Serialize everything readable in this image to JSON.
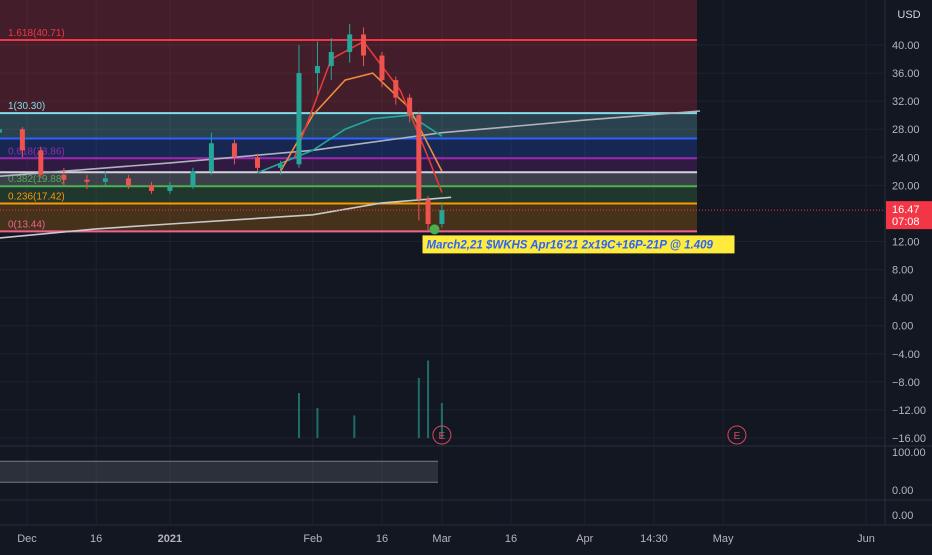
{
  "chart_data": {
    "type": "candlestick",
    "title": "",
    "currency": "USD",
    "time_axis": {
      "ticks": [
        {
          "label": "Dec",
          "date": "2020-12-01",
          "bold": false
        },
        {
          "label": "16",
          "date": "2020-12-16",
          "bold": false
        },
        {
          "label": "2021",
          "date": "2021-01-01",
          "bold": true
        },
        {
          "label": "Feb",
          "date": "2021-02-01",
          "bold": false
        },
        {
          "label": "16",
          "date": "2021-02-16",
          "bold": false
        },
        {
          "label": "Mar",
          "date": "2021-03-01",
          "bold": false
        },
        {
          "label": "16",
          "date": "2021-03-16",
          "bold": false
        },
        {
          "label": "Apr",
          "date": "2021-04-01",
          "bold": false
        },
        {
          "label": "14:30",
          "date": "2021-04-16",
          "bold": false
        },
        {
          "label": "May",
          "date": "2021-05-01",
          "bold": false
        },
        {
          "label": "Jun",
          "date": "2021-06-01",
          "bold": false
        }
      ]
    },
    "price_axis": {
      "ticks": [
        "40.00",
        "36.00",
        "32.00",
        "28.00",
        "24.00",
        "20.00",
        "12.00",
        "8.00",
        "4.00",
        "0.00",
        "−4.00",
        "−8.00",
        "−12.00",
        "−16.00"
      ],
      "range": [
        -16.5,
        43
      ]
    },
    "last_price": {
      "value": 16.47,
      "label": "16.47",
      "countdown": "07:08",
      "color": "#f23645"
    },
    "fib_levels": [
      {
        "label": "1.618(40.71)",
        "value": 40.71,
        "color": "#f23645",
        "show_label": true
      },
      {
        "label": "1(30.30)",
        "value": 30.3,
        "color": "#80deea",
        "show_label": true
      },
      {
        "label": "0.786(26.68)",
        "value": 26.68,
        "color": "#2962ff",
        "show_label": false
      },
      {
        "label": "0.618(23.86)",
        "value": 23.86,
        "color": "#9c27b0",
        "show_label": true
      },
      {
        "label": "0.5(21.87)",
        "value": 21.87,
        "color": "#d1d4dc",
        "show_label": false
      },
      {
        "label": "0.382(19.88)",
        "value": 19.88,
        "color": "#4caf50",
        "show_label": true
      },
      {
        "label": "0.236(17.42)",
        "value": 17.42,
        "color": "#ff9800",
        "show_label": true
      },
      {
        "label": "0(13.44)",
        "value": 13.44,
        "color": "#f06292",
        "show_label": true
      }
    ],
    "price_series": [
      {
        "date": "2020-11-25",
        "open": 27.5,
        "high": 29.5,
        "low": 26.5,
        "close": 28.0
      },
      {
        "date": "2020-11-30",
        "open": 28.0,
        "high": 28.3,
        "low": 24.0,
        "close": 25.0
      },
      {
        "date": "2020-12-04",
        "open": 25.0,
        "high": 25.5,
        "low": 21.0,
        "close": 21.5
      },
      {
        "date": "2020-12-09",
        "open": 21.5,
        "high": 22.5,
        "low": 19.8,
        "close": 20.8
      },
      {
        "date": "2020-12-14",
        "open": 20.8,
        "high": 21.5,
        "low": 19.5,
        "close": 20.5
      },
      {
        "date": "2020-12-18",
        "open": 20.5,
        "high": 22.0,
        "low": 20.0,
        "close": 21.0
      },
      {
        "date": "2020-12-23",
        "open": 21.0,
        "high": 21.5,
        "low": 19.5,
        "close": 20.0
      },
      {
        "date": "2020-12-28",
        "open": 20.0,
        "high": 20.5,
        "low": 18.8,
        "close": 19.2
      },
      {
        "date": "2021-01-01",
        "open": 19.2,
        "high": 20.5,
        "low": 18.8,
        "close": 19.8
      },
      {
        "date": "2021-01-06",
        "open": 19.8,
        "high": 22.5,
        "low": 19.5,
        "close": 22.0
      },
      {
        "date": "2021-01-10",
        "open": 22.0,
        "high": 27.5,
        "low": 21.5,
        "close": 26.0
      },
      {
        "date": "2021-01-15",
        "open": 26.0,
        "high": 26.5,
        "low": 23.0,
        "close": 24.0
      },
      {
        "date": "2021-01-20",
        "open": 24.0,
        "high": 24.5,
        "low": 22.0,
        "close": 22.5
      },
      {
        "date": "2021-01-25",
        "open": 22.5,
        "high": 23.5,
        "low": 21.5,
        "close": 23.0
      },
      {
        "date": "2021-01-29",
        "open": 23.0,
        "high": 40.0,
        "low": 22.5,
        "close": 36.0
      },
      {
        "date": "2021-02-02",
        "open": 36.0,
        "high": 40.5,
        "low": 33.0,
        "close": 37.0
      },
      {
        "date": "2021-02-05",
        "open": 37.0,
        "high": 41.0,
        "low": 35.0,
        "close": 39.0
      },
      {
        "date": "2021-02-09",
        "open": 39.0,
        "high": 43.0,
        "low": 37.5,
        "close": 41.5
      },
      {
        "date": "2021-02-12",
        "open": 41.5,
        "high": 42.5,
        "low": 37.0,
        "close": 38.5
      },
      {
        "date": "2021-02-16",
        "open": 38.5,
        "high": 39.0,
        "low": 34.0,
        "close": 35.0
      },
      {
        "date": "2021-02-19",
        "open": 35.0,
        "high": 35.5,
        "low": 31.5,
        "close": 32.5
      },
      {
        "date": "2021-02-22",
        "open": 32.5,
        "high": 33.0,
        "low": 29.0,
        "close": 30.0
      },
      {
        "date": "2021-02-24",
        "open": 30.0,
        "high": 30.5,
        "low": 15.0,
        "close": 18.0
      },
      {
        "date": "2021-02-26",
        "open": 18.0,
        "high": 18.5,
        "low": 13.5,
        "close": 14.5
      },
      {
        "date": "2021-03-01",
        "open": 14.5,
        "high": 17.5,
        "low": 14.0,
        "close": 16.47
      }
    ],
    "moving_averages": [
      {
        "color": "#c9c9c9",
        "points": [
          {
            "date": "2020-11-25",
            "value": 12.5
          },
          {
            "date": "2020-12-16",
            "value": 13.8
          },
          {
            "date": "2021-01-01",
            "value": 14.5
          },
          {
            "date": "2021-02-01",
            "value": 15.8
          },
          {
            "date": "2021-02-16",
            "value": 17.5
          },
          {
            "date": "2021-03-03",
            "value": 18.3
          }
        ]
      },
      {
        "color": "#b0b3bd",
        "points": [
          {
            "date": "2020-11-25",
            "value": 21.3
          },
          {
            "date": "2021-01-01",
            "value": 23.2
          },
          {
            "date": "2021-02-01",
            "value": 25.0
          },
          {
            "date": "2021-03-01",
            "value": 27.5
          },
          {
            "date": "2021-04-01",
            "value": 29.3
          },
          {
            "date": "2021-04-26",
            "value": 30.6
          }
        ]
      },
      {
        "color": "#26a69a",
        "points": [
          {
            "date": "2021-01-20",
            "value": 21.8
          },
          {
            "date": "2021-02-01",
            "value": 25.0
          },
          {
            "date": "2021-02-08",
            "value": 28.0
          },
          {
            "date": "2021-02-14",
            "value": 29.5
          },
          {
            "date": "2021-02-22",
            "value": 30.0
          },
          {
            "date": "2021-03-01",
            "value": 27.0
          }
        ]
      },
      {
        "color": "#ef8a3c",
        "points": [
          {
            "date": "2021-01-25",
            "value": 22.0
          },
          {
            "date": "2021-02-01",
            "value": 30.0
          },
          {
            "date": "2021-02-08",
            "value": 35.0
          },
          {
            "date": "2021-02-14",
            "value": 36.0
          },
          {
            "date": "2021-02-22",
            "value": 31.0
          },
          {
            "date": "2021-03-01",
            "value": 22.0
          }
        ]
      },
      {
        "color": "#e53935",
        "points": [
          {
            "date": "2021-01-28",
            "value": 24.0
          },
          {
            "date": "2021-02-05",
            "value": 38.0
          },
          {
            "date": "2021-02-12",
            "value": 40.5
          },
          {
            "date": "2021-02-20",
            "value": 33.5
          },
          {
            "date": "2021-02-26",
            "value": 24.0
          },
          {
            "date": "2021-03-01",
            "value": 19.0
          }
        ]
      }
    ],
    "annotation": {
      "text": "March2,21 $WKHS Apr16'21 2x19C+16P-21P @ 1.409",
      "date": "2021-03-02",
      "value": 13.44,
      "background": "#ffeb3b",
      "text_color": "#2962ff"
    },
    "earnings_markers": [
      {
        "label": "E",
        "date": "2021-03-01"
      },
      {
        "label": "E",
        "date": "2021-05-04"
      }
    ],
    "volume": [
      {
        "date": "2021-01-29",
        "value": 9.0
      },
      {
        "date": "2021-02-02",
        "value": 6.0
      },
      {
        "date": "2021-02-10",
        "value": 4.5
      },
      {
        "date": "2021-02-24",
        "value": 12.0
      },
      {
        "date": "2021-02-26",
        "value": 15.5
      },
      {
        "date": "2021-03-01",
        "value": 7.0
      }
    ],
    "oscillator_1": {
      "ticks": [
        "100.00",
        "0.00"
      ],
      "range": [
        0,
        100
      ],
      "band": [
        28,
        78
      ]
    },
    "oscillator_2": {
      "ticks": [
        "0.00"
      ]
    }
  }
}
